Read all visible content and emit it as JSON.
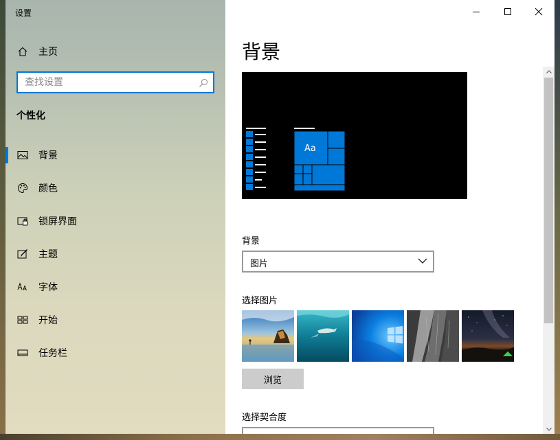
{
  "window": {
    "title": "设置"
  },
  "sidebar": {
    "home_label": "主页",
    "search_placeholder": "查找设置",
    "section_title": "个性化",
    "items": [
      {
        "label": "背景",
        "icon": "picture-icon",
        "active": true
      },
      {
        "label": "颜色",
        "icon": "palette-icon"
      },
      {
        "label": "锁屏界面",
        "icon": "lock-screen-icon"
      },
      {
        "label": "主题",
        "icon": "theme-brush-icon"
      },
      {
        "label": "字体",
        "icon": "font-icon"
      },
      {
        "label": "开始",
        "icon": "start-tiles-icon"
      },
      {
        "label": "任务栏",
        "icon": "taskbar-icon"
      }
    ]
  },
  "content": {
    "page_title": "背景",
    "preview": {
      "tile_text": "Aa"
    },
    "background_label": "背景",
    "background_value": "图片",
    "choose_picture_label": "选择图片",
    "pictures": [
      "beach-rock-icon",
      "underwater-swimmer-icon",
      "windows-logo-icon",
      "rock-cliff-icon",
      "milky-way-night-icon"
    ],
    "browse_label": "浏览",
    "fit_label": "选择契合度"
  },
  "colors": {
    "accent": "#0078d7"
  }
}
